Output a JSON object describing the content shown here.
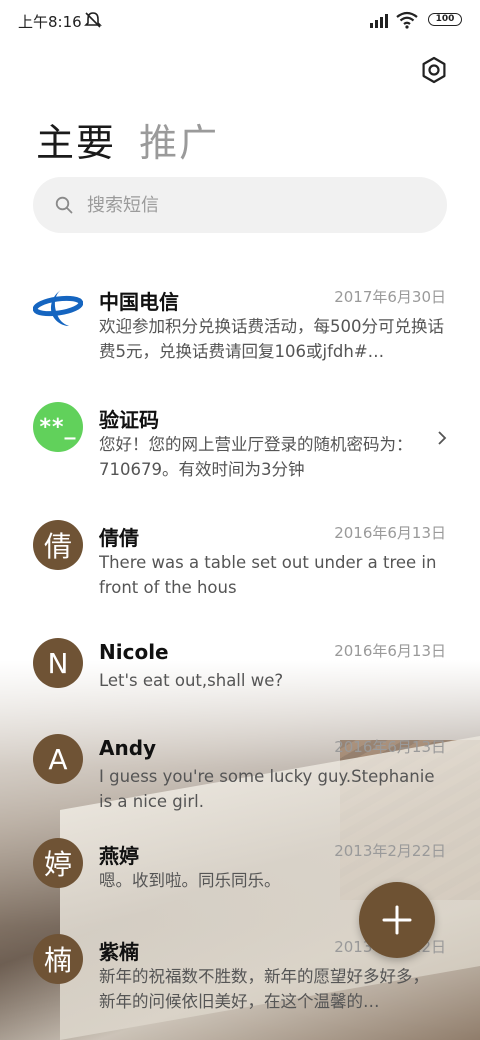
{
  "status": {
    "time": "上午8:16",
    "battery": "100",
    "icons": [
      "mute-icon",
      "signal-icon",
      "wifi-icon",
      "battery-icon"
    ]
  },
  "header": {
    "settings_icon": "gear-icon",
    "tabs": [
      {
        "label": "主要",
        "active": true
      },
      {
        "label": "推广",
        "active": false
      }
    ]
  },
  "search": {
    "placeholder": "搜索短信",
    "icon": "search-icon"
  },
  "messages": [
    {
      "name": "中国电信",
      "date": "2017年6月30日",
      "preview": "欢迎参加积分兑换话费活动，每500分可兑换话费5元，兑换话费请回复106或jfdh#…",
      "avatar_text": "",
      "avatar_type": "telecom-logo"
    },
    {
      "name": "验证码",
      "date": "",
      "preview": "您好！您的网上营业厅登录的随机密码为：710679。有效时间为3分钟",
      "avatar_text": "**_",
      "avatar_type": "green"
    },
    {
      "name": "倩倩",
      "date": "2016年6月13日",
      "preview": "There was a table set out under a tree in front of the hous",
      "avatar_text": "倩",
      "avatar_type": "brown"
    },
    {
      "name": "Nicole",
      "date": "2016年6月13日",
      "preview": "Let's eat out,shall we?",
      "avatar_text": "N",
      "avatar_type": "brown"
    },
    {
      "name": "Andy",
      "date": "2016年6月13日",
      "preview": "I guess you're some lucky guy.Stephanie is a nice girl.",
      "avatar_text": "A",
      "avatar_type": "brown"
    },
    {
      "name": "燕婷",
      "date": "2013年2月22日",
      "preview": "嗯。收到啦。同乐同乐。",
      "avatar_text": "婷",
      "avatar_type": "brown"
    },
    {
      "name": "紫楠",
      "date": "2013年2月22日",
      "preview": "新年的祝福数不胜数，新年的愿望好多好多，新年的问候依旧美好，在这个温馨的…",
      "avatar_text": "楠",
      "avatar_type": "brown"
    }
  ],
  "fab": {
    "icon": "plus-icon"
  },
  "colors": {
    "avatar_brown": "#6f5335",
    "avatar_green": "#61d15b",
    "telecom_blue": "#1565c0",
    "fab": "#6e5233"
  }
}
